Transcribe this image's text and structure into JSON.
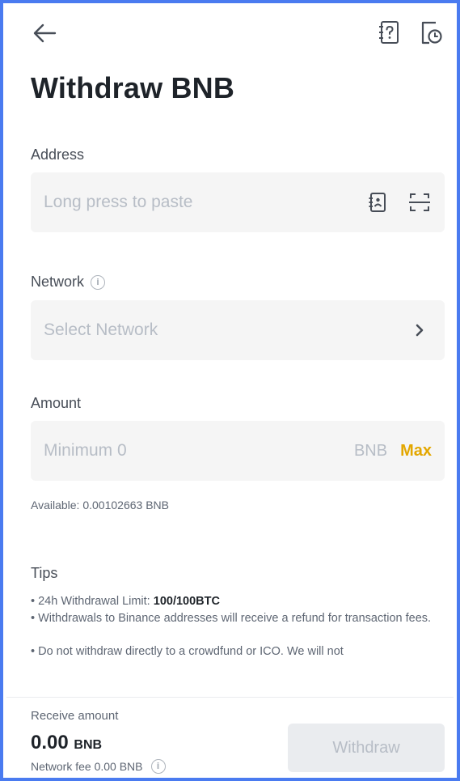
{
  "header": {
    "back_icon": "arrow-left-icon",
    "help_icon": "help-question-icon",
    "history_icon": "history-icon",
    "title": "Withdraw BNB"
  },
  "address": {
    "label": "Address",
    "placeholder": "Long press to paste",
    "address_book_icon": "address-book-icon",
    "scan_icon": "scan-icon"
  },
  "network": {
    "label": "Network",
    "info_icon": "info-icon",
    "placeholder": "Select Network",
    "chevron_icon": "chevron-right-icon"
  },
  "amount": {
    "label": "Amount",
    "placeholder": "Minimum 0",
    "unit": "BNB",
    "max_label": "Max",
    "available": "Available: 0.00102663 BNB"
  },
  "tips": {
    "title": "Tips",
    "limit_prefix": "• 24h Withdrawal Limit: ",
    "limit_value": "100/100BTC",
    "refund": "• Withdrawals to Binance addresses will receive a refund for transaction fees.",
    "ico": "• Do not withdraw directly to a crowdfund or ICO. We will not"
  },
  "footer": {
    "receive_label": "Receive amount",
    "receive_value": "0.00",
    "receive_unit": "BNB",
    "network_fee": "Network fee 0.00 BNB",
    "withdraw_label": "Withdraw"
  },
  "colors": {
    "accent_max": "#e3a700",
    "frame_border": "#4a7bf0",
    "field_bg": "#f5f5f5",
    "disabled_button_bg": "#eaecef"
  }
}
